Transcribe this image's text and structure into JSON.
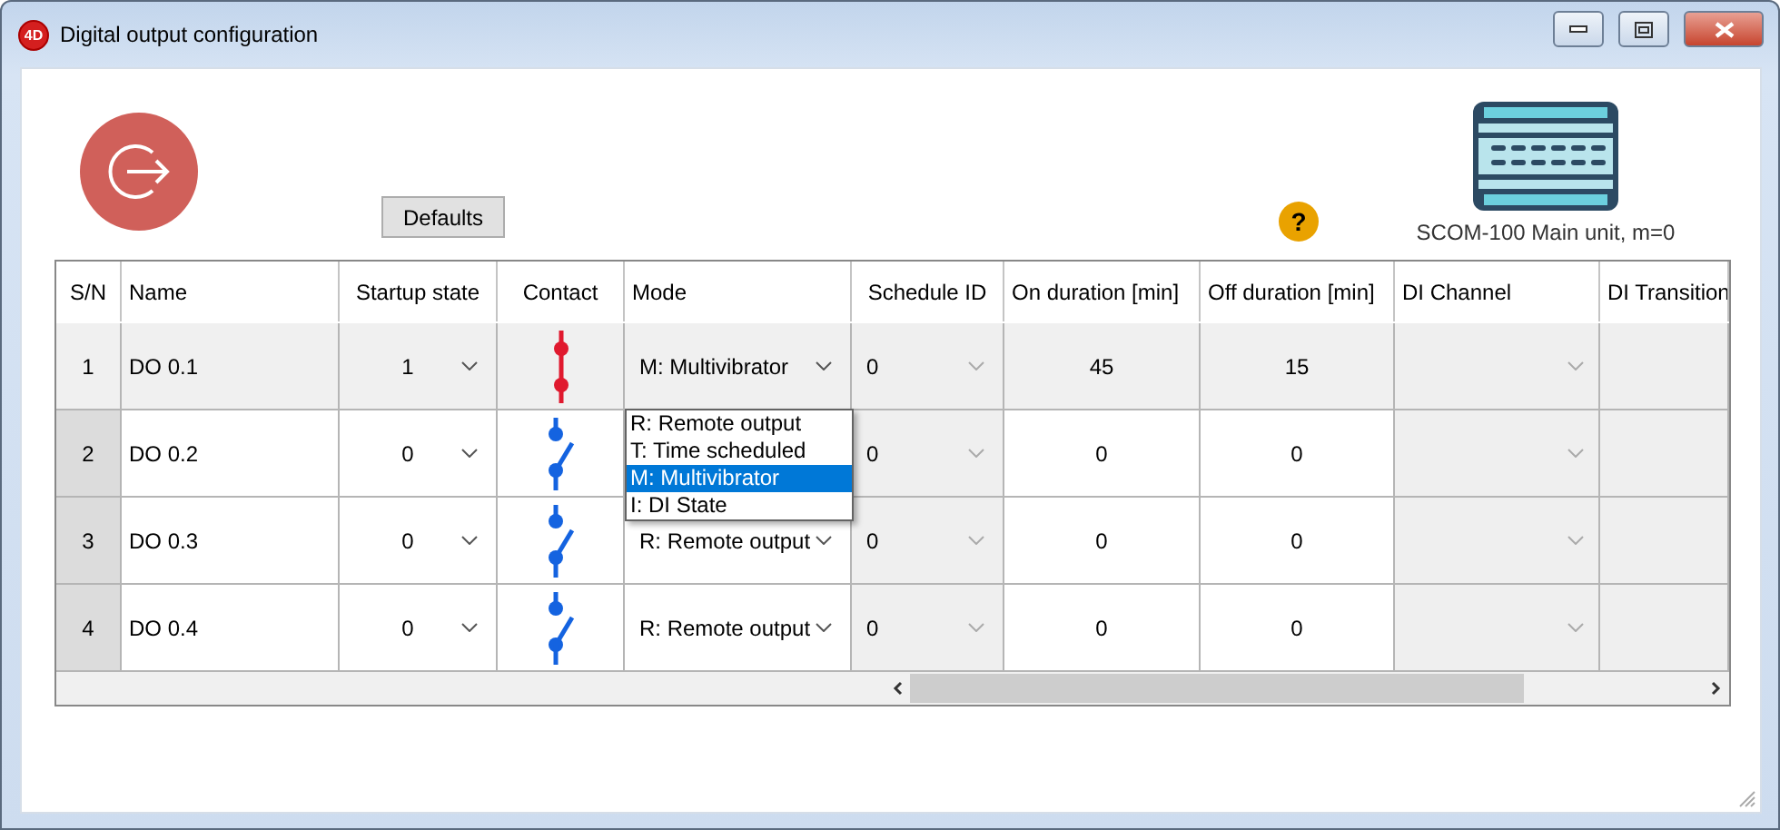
{
  "window": {
    "app_logo": "4D",
    "title": "Digital output configuration"
  },
  "toolbar": {
    "defaults_button": "Defaults",
    "device_label": "SCOM-100 Main unit, m=0",
    "help": "?"
  },
  "table": {
    "columns": [
      "S/N",
      "Name",
      "Startup state",
      "Contact",
      "Mode",
      "Schedule ID",
      "On duration [min]",
      "Off duration [min]",
      "DI Channel",
      "DI Transition"
    ],
    "rows": [
      {
        "sn": "1",
        "name": "DO 0.1",
        "startup": "1",
        "contact_closed": true,
        "mode": "M: Multivibrator",
        "schedule_id": "0",
        "on_duration": "45",
        "off_duration": "15",
        "selected": true
      },
      {
        "sn": "2",
        "name": "DO 0.2",
        "startup": "0",
        "contact_closed": false,
        "schedule_id": "0",
        "on_duration": "0",
        "off_duration": "0",
        "selected": false
      },
      {
        "sn": "3",
        "name": "DO 0.3",
        "startup": "0",
        "contact_closed": false,
        "mode": "R: Remote output",
        "schedule_id": "0",
        "on_duration": "0",
        "off_duration": "0",
        "selected": false
      },
      {
        "sn": "4",
        "name": "DO 0.4",
        "startup": "0",
        "contact_closed": false,
        "mode": "R: Remote output",
        "schedule_id": "0",
        "on_duration": "0",
        "off_duration": "0",
        "selected": false
      }
    ]
  },
  "mode_dropdown": {
    "options": [
      {
        "label": "R: Remote output",
        "selected": false
      },
      {
        "label": "T: Time scheduled",
        "selected": false
      },
      {
        "label": "M: Multivibrator",
        "selected": true
      },
      {
        "label": "I: DI State",
        "selected": false
      }
    ]
  }
}
